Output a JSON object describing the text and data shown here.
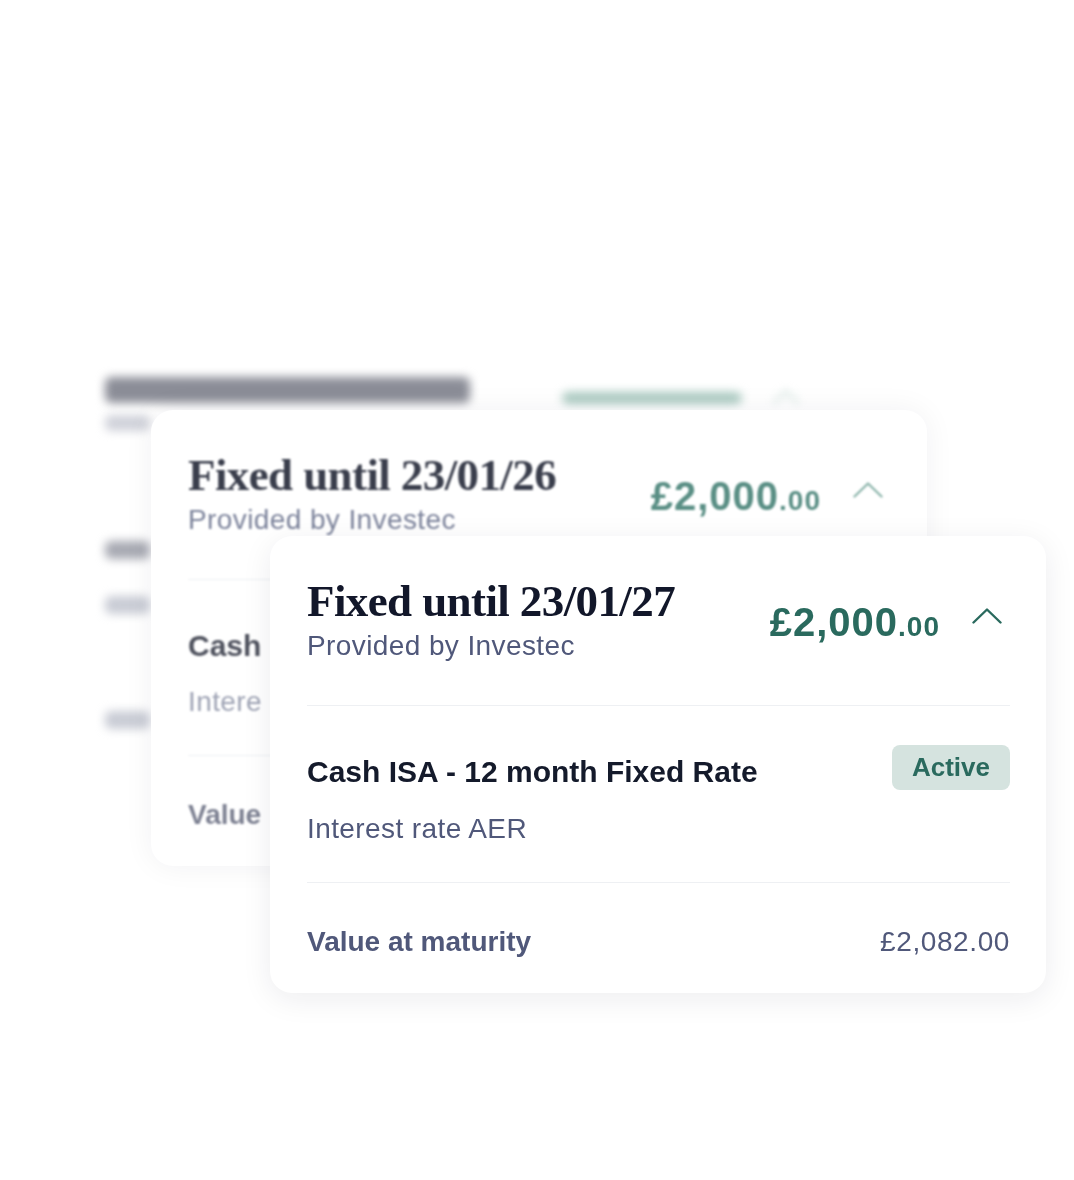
{
  "cards": [
    {
      "kind": "far"
    },
    {
      "kind": "middle",
      "title": "Fixed until 23/01/26",
      "provider": "Provided by Investec",
      "amount": "£2,000",
      "amount_pence": ".00",
      "expanded": true,
      "product": "Cash",
      "rate_label": "Intere",
      "maturity_label": "Value"
    },
    {
      "kind": "front",
      "title": "Fixed until 23/01/27",
      "provider": "Provided by Investec",
      "amount": "£2,000",
      "amount_pence": ".00",
      "expanded": true,
      "product": "Cash ISA - 12 month Fixed Rate",
      "status": "Active",
      "rate_label": "Interest rate AER",
      "maturity_label": "Value at maturity",
      "maturity_value": "£2,082.00"
    }
  ]
}
